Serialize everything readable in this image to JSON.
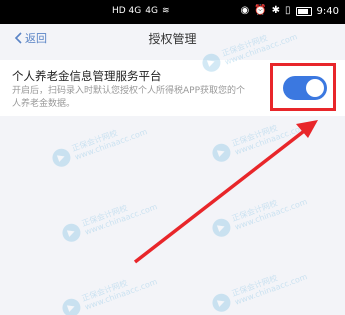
{
  "status_bar": {
    "time": "9:40",
    "signal_left": "HD 4G",
    "signal_right": "4G",
    "icons": [
      "eye-icon",
      "alarm-icon",
      "bluetooth-icon",
      "vibrate-icon",
      "battery-icon"
    ]
  },
  "nav": {
    "back_label": "返回",
    "title": "授权管理"
  },
  "setting": {
    "title": "个人养老金信息管理服务平台",
    "description": "开启后，扫码录入时默认您授权个人所得税APP获取您的个人养老金数据。",
    "toggle_on": true
  },
  "watermark": {
    "text_line1": "正保会计网校",
    "text_line2": "www.chinaacc.com"
  },
  "colors": {
    "accent": "#3b78e0",
    "back_link": "#5a84c6",
    "highlight": "#e8262a",
    "background": "#f3f4f8"
  }
}
